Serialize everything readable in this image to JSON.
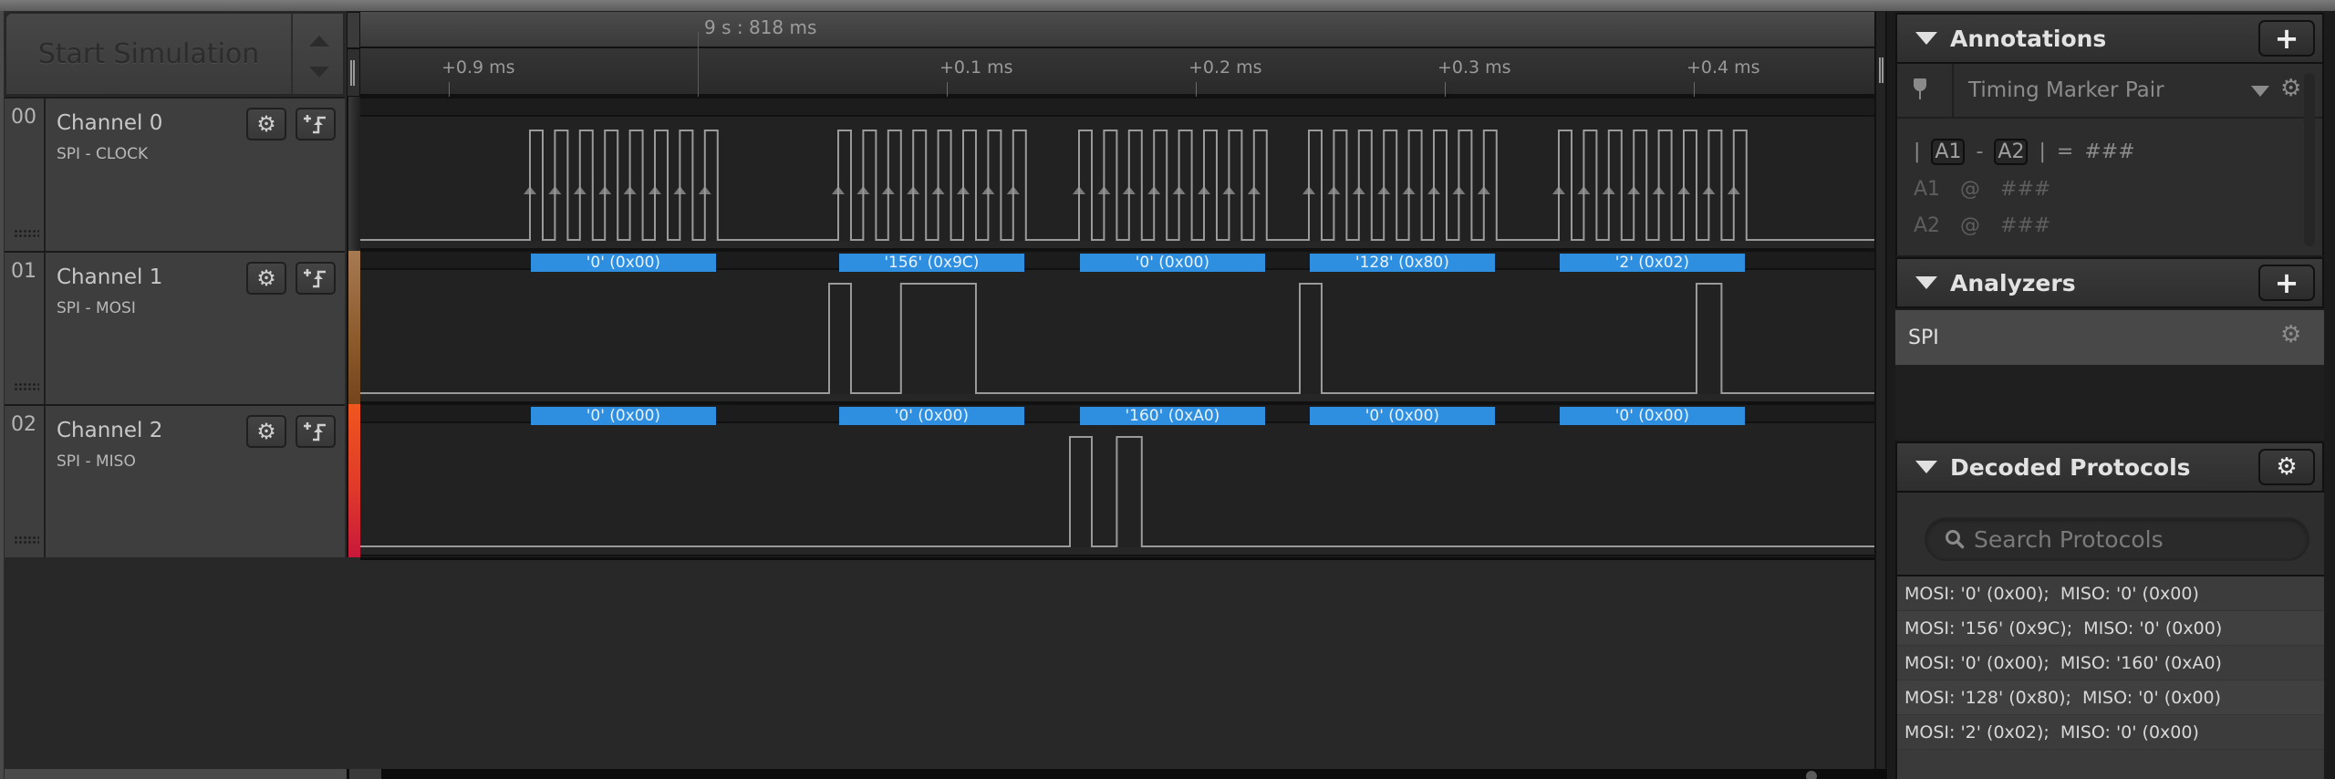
{
  "toolbar": {
    "start_label": "Start Simulation"
  },
  "timeline": {
    "timestamp": "9 s : 818 ms",
    "ticks": [
      {
        "label": "+0.9 ms",
        "offset_ms": -0.1
      },
      {
        "label": "+0.1 ms",
        "offset_ms": 0.1
      },
      {
        "label": "+0.2 ms",
        "offset_ms": 0.2
      },
      {
        "label": "+0.3 ms",
        "offset_ms": 0.3
      },
      {
        "label": "+0.4 ms",
        "offset_ms": 0.4
      }
    ]
  },
  "channels": [
    {
      "number": "00",
      "name": "Channel 0",
      "subtitle": "SPI - CLOCK",
      "color": "#2c2c2c",
      "decoded": []
    },
    {
      "number": "01",
      "name": "Channel 1",
      "subtitle": "SPI - MOSI",
      "color": "#8a5a2a",
      "decoded": [
        "'0' (0x00)",
        "'156' (0x9C)",
        "'0' (0x00)",
        "'128' (0x80)",
        "'2' (0x02)"
      ]
    },
    {
      "number": "02",
      "name": "Channel 2",
      "subtitle": "SPI - MISO",
      "color": "#e03a2a",
      "decoded": [
        "'0' (0x00)",
        "'0' (0x00)",
        "'160' (0xA0)",
        "'0' (0x00)",
        "'0' (0x00)"
      ]
    }
  ],
  "signals": {
    "clock_bursts": 5,
    "bits_per_burst": 8,
    "mosi_bytes": [
      0,
      156,
      0,
      128,
      2
    ],
    "miso_bytes": [
      0,
      0,
      160,
      0,
      0
    ]
  },
  "annotations": {
    "title": "Annotations",
    "add_label": "+",
    "marker_type": "Timing Marker Pair",
    "formula": {
      "bar_left": "|",
      "a1": "A1",
      "minus": "-",
      "a2": "A2",
      "bar_right": "|",
      "equals": "=",
      "value": "###"
    },
    "rows": [
      {
        "name": "A1",
        "at": "@",
        "value": "###"
      },
      {
        "name": "A2",
        "at": "@",
        "value": "###"
      }
    ]
  },
  "analyzers": {
    "title": "Analyzers",
    "add_label": "+",
    "items": [
      {
        "name": "SPI"
      }
    ]
  },
  "decoded_protocols": {
    "title": "Decoded Protocols",
    "search_placeholder": "Search Protocols",
    "items": [
      "MOSI: '0' (0x00);  MISO: '0' (0x00)",
      "MOSI: '156' (0x9C);  MISO: '0' (0x00)",
      "MOSI: '0' (0x00);  MISO: '160' (0xA0)",
      "MOSI: '128' (0x80);  MISO: '0' (0x00)",
      "MOSI: '2' (0x02);  MISO: '0' (0x00)"
    ]
  },
  "colors": {
    "decoded_box": "#2e8ee0",
    "signal_line": "#9a9a9a"
  }
}
